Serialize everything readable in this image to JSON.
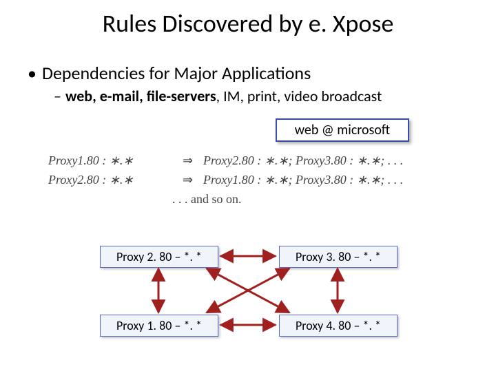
{
  "title": "Rules Discovered by e. Xpose",
  "bullet1": {
    "dot": "•",
    "text": "Dependencies for Major Applications"
  },
  "bullet2": {
    "dash": "–",
    "bold_prefix": "web, e-mail, file-servers",
    "rest": ", IM, print, video broadcast"
  },
  "badge": "web @ microsoft",
  "math": {
    "row1": {
      "left": "Proxy1.80 : ∗.∗",
      "impl": "⇒",
      "right": "Proxy2.80 : ∗.∗;  Proxy3.80 : ∗.∗;  . . ."
    },
    "row2": {
      "left": "Proxy2.80 : ∗.∗",
      "impl": "⇒",
      "right": "Proxy1.80 : ∗.∗;  Proxy3.80 : ∗.∗;  . . ."
    },
    "row3": ". . .     and so on."
  },
  "nodes": {
    "p2": "Proxy 2. 80 – *. *",
    "p3": "Proxy 3. 80 – *. *",
    "p1": "Proxy 1. 80 – *. *",
    "p4": "Proxy 4. 80 – *. *"
  }
}
